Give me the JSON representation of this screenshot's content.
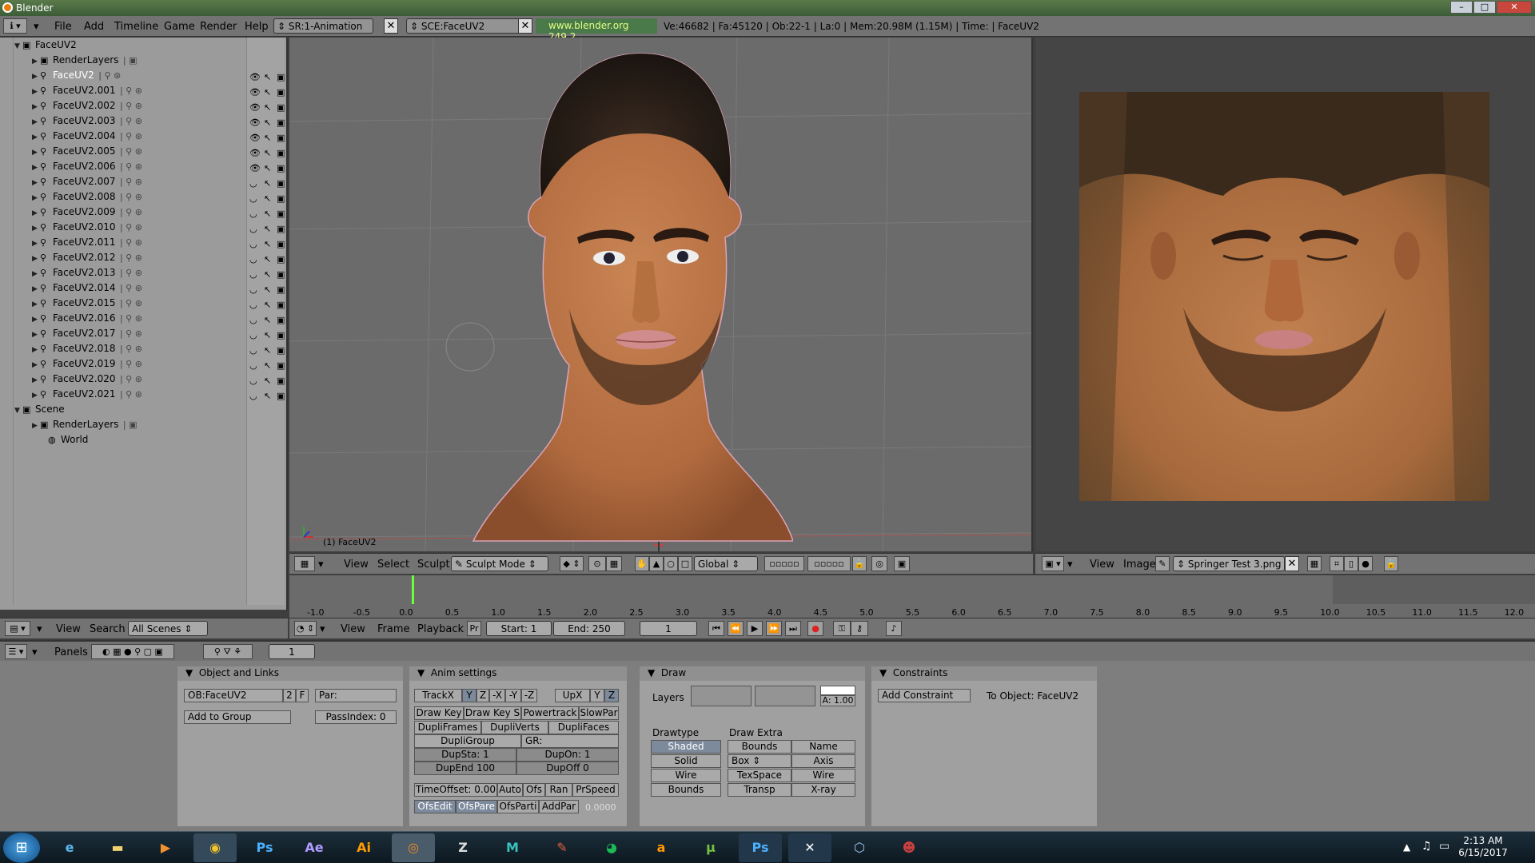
{
  "window": {
    "title": "Blender"
  },
  "menu": [
    "File",
    "Add",
    "Timeline",
    "Game",
    "Render",
    "Help"
  ],
  "screen_field": "SR:1-Animation",
  "scene_field": "SCE:FaceUV2",
  "url": "www.blender.org 249.2",
  "stats": "Ve:46682 | Fa:45120 | Ob:22-1 | La:0 | Mem:20.98M (1.15M) | Time: | FaceUV2",
  "outliner": {
    "root": "FaceUV2",
    "renderlayers": "RenderLayers",
    "items": [
      "FaceUV2",
      "FaceUV2.001",
      "FaceUV2.002",
      "FaceUV2.003",
      "FaceUV2.004",
      "FaceUV2.005",
      "FaceUV2.006",
      "FaceUV2.007",
      "FaceUV2.008",
      "FaceUV2.009",
      "FaceUV2.010",
      "FaceUV2.011",
      "FaceUV2.012",
      "FaceUV2.013",
      "FaceUV2.014",
      "FaceUV2.015",
      "FaceUV2.016",
      "FaceUV2.017",
      "FaceUV2.018",
      "FaceUV2.019",
      "FaceUV2.020",
      "FaceUV2.021"
    ],
    "scene": "Scene",
    "scene_renderlayers": "RenderLayers",
    "world": "World",
    "header": {
      "view": "View",
      "search": "Search",
      "scenes": "All Scenes"
    }
  },
  "view3d": {
    "object_label": "(1) FaceUV2",
    "header": {
      "view": "View",
      "select": "Select",
      "sculpt": "Sculpt",
      "mode": "Sculpt Mode",
      "orientation": "Global"
    }
  },
  "image_editor": {
    "header": {
      "view": "View",
      "image": "Image",
      "file": "Springer Test 3.png"
    }
  },
  "timeline": {
    "ticks": [
      "-1.0",
      "-0.5",
      "0.0",
      "0.5",
      "1.0",
      "1.5",
      "2.0",
      "2.5",
      "3.0",
      "3.5",
      "4.0",
      "4.5",
      "5.0",
      "5.5",
      "6.0",
      "6.5",
      "7.0",
      "7.5",
      "8.0",
      "8.5",
      "9.0",
      "9.5",
      "10.0",
      "10.5",
      "11.0",
      "11.5",
      "12.0"
    ],
    "header": {
      "view": "View",
      "frame": "Frame",
      "playback": "Playback",
      "pr": "Pr",
      "start": "Start: 1",
      "end": "End: 250",
      "current": "1"
    }
  },
  "buttons": {
    "header": {
      "panels": "Panels",
      "frame": "1"
    },
    "object_links": {
      "title": "Object and Links",
      "ob": "OB:FaceUV2",
      "users": "2",
      "f": "F",
      "par": "Par:",
      "add_group": "Add to Group",
      "pass_index": "PassIndex: 0"
    },
    "anim": {
      "title": "Anim settings",
      "track": "TrackX",
      "y": "Y",
      "z": "Z",
      "nx": "-X",
      "ny": "-Y",
      "nz": "-Z",
      "up": "UpX",
      "uy": "Y",
      "uz": "Z",
      "draw_key": "Draw Key",
      "draw_key_s": "Draw Key S",
      "powertrack": "Powertrack",
      "slowpar": "SlowPar",
      "dupliframes": "DupliFrames",
      "dupliverts": "DupliVerts",
      "duplifaces": "DupliFaces",
      "dupligroup": "DupliGroup",
      "gr": "GR:",
      "dupsta": "DupSta: 1",
      "dupon": "DupOn: 1",
      "dupend": "DupEnd 100",
      "dupoff": "DupOff 0",
      "timeoffset": "TimeOffset: 0.00",
      "auto": "Auto",
      "ofs": "Ofs",
      "ran": "Ran",
      "prspeed": "PrSpeed",
      "ofsedit": "OfsEdit",
      "ofspare": "OfsPare",
      "ofsparti": "OfsParti",
      "addpar": "AddPar",
      "val": "0.0000"
    },
    "draw": {
      "title": "Draw",
      "layers": "Layers",
      "a": "A: 1.00",
      "drawtype": "Drawtype",
      "draw_extra": "Draw Extra",
      "types": [
        "Shaded",
        "Solid",
        "Wire",
        "Bounds"
      ],
      "bounds": "Bounds",
      "name": "Name",
      "box": "Box",
      "axis": "Axis",
      "texspace": "TexSpace",
      "wire": "Wire",
      "transp": "Transp",
      "xray": "X-ray"
    },
    "constraints": {
      "title": "Constraints",
      "add": "Add Constraint",
      "to_object": "To Object: FaceUV2"
    }
  },
  "taskbar": {
    "apps": [
      "IE",
      "Explorer",
      "Media",
      "Chrome",
      "Ps",
      "Ae",
      "Ai",
      "Blender",
      "ZBrush",
      "Maya",
      "Pencil",
      "Spotify",
      "Amazon",
      "uTorrent",
      "Ps",
      "X",
      "Box",
      "Avatar"
    ],
    "time": "2:13 AM",
    "date": "6/15/2017"
  },
  "colors": {
    "accent": "#e87d0d",
    "panel": "#a0a0a0",
    "header": "#737373",
    "selected": "#7c8a9c"
  }
}
